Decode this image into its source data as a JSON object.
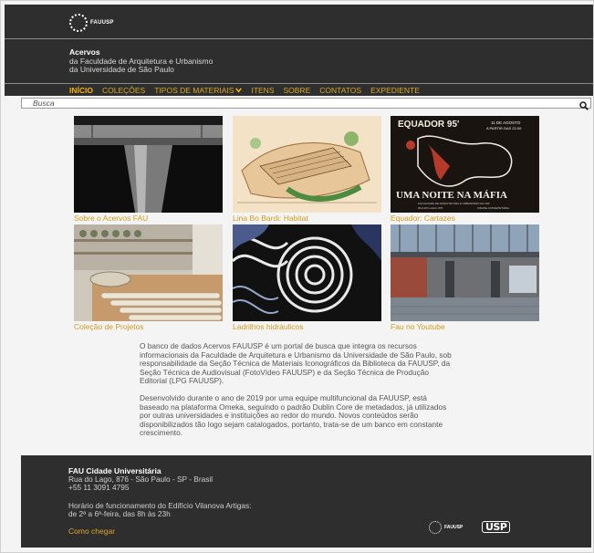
{
  "brand": {
    "logo_text": "FAUUSP"
  },
  "site": {
    "title_line1": "Acervos",
    "title_line2": "da Faculdade de Arquitetura e Urbanismo",
    "title_line3": "da Universidade de São Paulo"
  },
  "nav": {
    "items": [
      {
        "label": "INÍCIO"
      },
      {
        "label": "COLEÇÕES"
      },
      {
        "label": "TIPOS DE MATERIAIS"
      },
      {
        "label": "ITENS"
      },
      {
        "label": "SOBRE"
      },
      {
        "label": "CONTATOS"
      },
      {
        "label": "EXPEDIENTE"
      }
    ]
  },
  "search": {
    "placeholder": "Busca",
    "value": ""
  },
  "tiles": [
    {
      "caption": "Sobre o Acervos FAU"
    },
    {
      "caption": "Lina Bo Bardi: Habitat"
    },
    {
      "caption": "Equador: Cartazes",
      "poster_title": "EQUADOR 95'",
      "poster_date": "11 DE AGOSTO",
      "poster_time": "A PARTIR DAS 22:00",
      "poster_headline": "UMA NOITE NA MÁFIA",
      "poster_footer1": "FACULDADE DE ARQUITETURA E URBANISMO DA USP",
      "poster_footer2": "RUA DO LAGO, 876",
      "poster_footer3": "CIDADE UNIVERSITÁRIA"
    },
    {
      "caption": "Coleção de Projetos"
    },
    {
      "caption": "Ladrilhos hidráulicos"
    },
    {
      "caption": "Fau no Youtube"
    }
  ],
  "description": {
    "p1": "O banco de dados Acervos FAUUSP é um portal de busca que integra os recursos informacionais da Faculdade de Arquitetura e Urbanismo da Universidade de São Paulo, sob responsabilidade da Seção Técnica de Materiais Iconográficos da Biblioteca da FAUUSP, da Seção Técnica de Audiovisual (FotoVídeo FAUUSP) e da Seção Técnica de Produção Editorial (LPG FAUUSP).",
    "p2": "Desenvolvido durante o ano de 2019 por uma equipe multifuncional da FAUUSP, está baseado na plataforma Omeka, seguindo o padrão Dublin Core de metadados, já utilizados por outras universidades e instituições ao redor do mundo. Novos conteúdos serão disponibilizados tão logo sejam catalogados, portanto, trata-se de um banco em constante crescimento."
  },
  "footer": {
    "title": "FAU Cidade Universitária",
    "address": "Rua do Lago, 876 - São Paulo - SP - Brasil",
    "phone": "+55 11 3091 4795",
    "hours_label": "Horário de funcionamento do Edifício Vilanova Artigas:",
    "hours_value": "de 2ª a 6ª-feira, das 8h às 23h",
    "link": "Como chegar",
    "logo_text": "FAUUSP",
    "usp_logo": "USP"
  },
  "colors": {
    "header_bg": "#2e2e2e",
    "accent": "#d9a829",
    "caption": "#d39b1e",
    "body_bg": "#f4f4f4"
  },
  "icons": {
    "search": "search-icon",
    "chevron": "chevron-down-icon",
    "logo": "fauusp-logo-icon"
  }
}
